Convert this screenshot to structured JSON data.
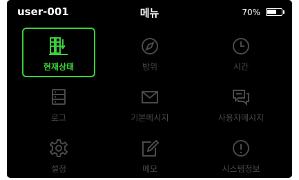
{
  "status_bar": {
    "device_name": "user-001",
    "title": "메뉴",
    "battery_percent_text": "70%",
    "battery_level": 0.7
  },
  "colors": {
    "selected": "#3ad13a",
    "inactive": "#4a4a4a",
    "background": "#000000"
  },
  "menu": {
    "items": [
      {
        "label": "현재상태",
        "icon": "status-icon",
        "selected": true
      },
      {
        "label": "방위",
        "icon": "compass-icon",
        "selected": false
      },
      {
        "label": "시간",
        "icon": "clock-icon",
        "selected": false
      },
      {
        "label": "로그",
        "icon": "log-icon",
        "selected": false
      },
      {
        "label": "기본메시지",
        "icon": "envelope-icon",
        "selected": false
      },
      {
        "label": "사용자메시지",
        "icon": "chat-icon",
        "selected": false
      },
      {
        "label": "설정",
        "icon": "gear-icon",
        "selected": false
      },
      {
        "label": "메모",
        "icon": "memo-icon",
        "selected": false
      },
      {
        "label": "시스템정보",
        "icon": "info-icon",
        "selected": false
      }
    ]
  }
}
